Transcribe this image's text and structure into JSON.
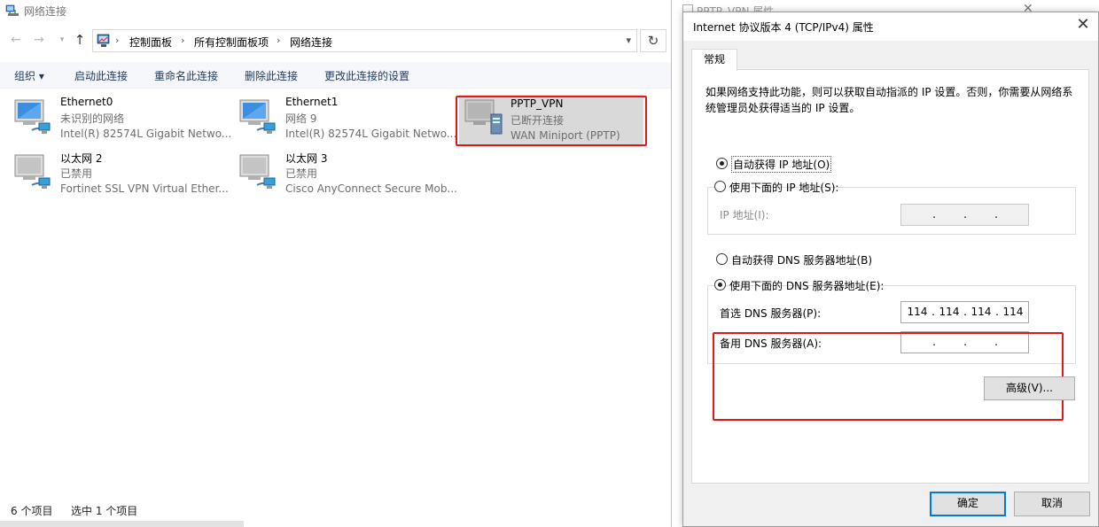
{
  "explorer": {
    "title": "网络连接",
    "breadcrumb": [
      "控制面板",
      "所有控制面板项",
      "网络连接"
    ],
    "commands": [
      "组织 ▾",
      "启动此连接",
      "重命名此连接",
      "删除此连接",
      "更改此连接的设置"
    ],
    "connections": [
      {
        "name": "Ethernet0",
        "status": "未识别的网络",
        "adapter": "Intel(R) 82574L Gigabit Netwo...",
        "icon": "ethernet-adapter-icon"
      },
      {
        "name": "Ethernet1",
        "status": "网络 9",
        "adapter": "Intel(R) 82574L Gigabit Netwo...",
        "icon": "ethernet-adapter-icon"
      },
      {
        "name": "PPTP_VPN",
        "status": "已断开连接",
        "adapter": "WAN Miniport (PPTP)",
        "icon": "vpn-adapter-icon"
      },
      {
        "name": "以太网 2",
        "status": "已禁用",
        "adapter": "Fortinet SSL VPN Virtual Ether...",
        "icon": "ethernet-adapter-icon"
      },
      {
        "name": "以太网 3",
        "status": "已禁用",
        "adapter": "Cisco AnyConnect Secure Mob...",
        "icon": "ethernet-adapter-icon"
      }
    ],
    "status": {
      "count": "6 个项目",
      "selected": "选中 1 个项目"
    }
  },
  "background_window": {
    "title": "PPTP_VPN 属性"
  },
  "dialog": {
    "title": "Internet 协议版本 4 (TCP/IPv4) 属性",
    "tab": "常规",
    "description": "如果网络支持此功能，则可以获取自动指派的 IP 设置。否则，你需要从网络系统管理员处获得适当的 IP 设置。",
    "auto_ip_label": "自动获得 IP 地址(O)",
    "manual_ip_label": "使用下面的 IP 地址(S):",
    "ip_address_label": "IP 地址(I):",
    "auto_dns_label": "自动获得 DNS 服务器地址(B)",
    "manual_dns_label": "使用下面的 DNS 服务器地址(E):",
    "preferred_dns_label": "首选 DNS 服务器(P):",
    "alternate_dns_label": "备用 DNS 服务器(A):",
    "preferred_dns": [
      "114",
      "114",
      "114",
      "114"
    ],
    "advanced_button": "高级(V)...",
    "ok_button": "确定",
    "cancel_button": "取消",
    "ip_mode": "manual-dns",
    "highlight_color": "#e01818"
  }
}
